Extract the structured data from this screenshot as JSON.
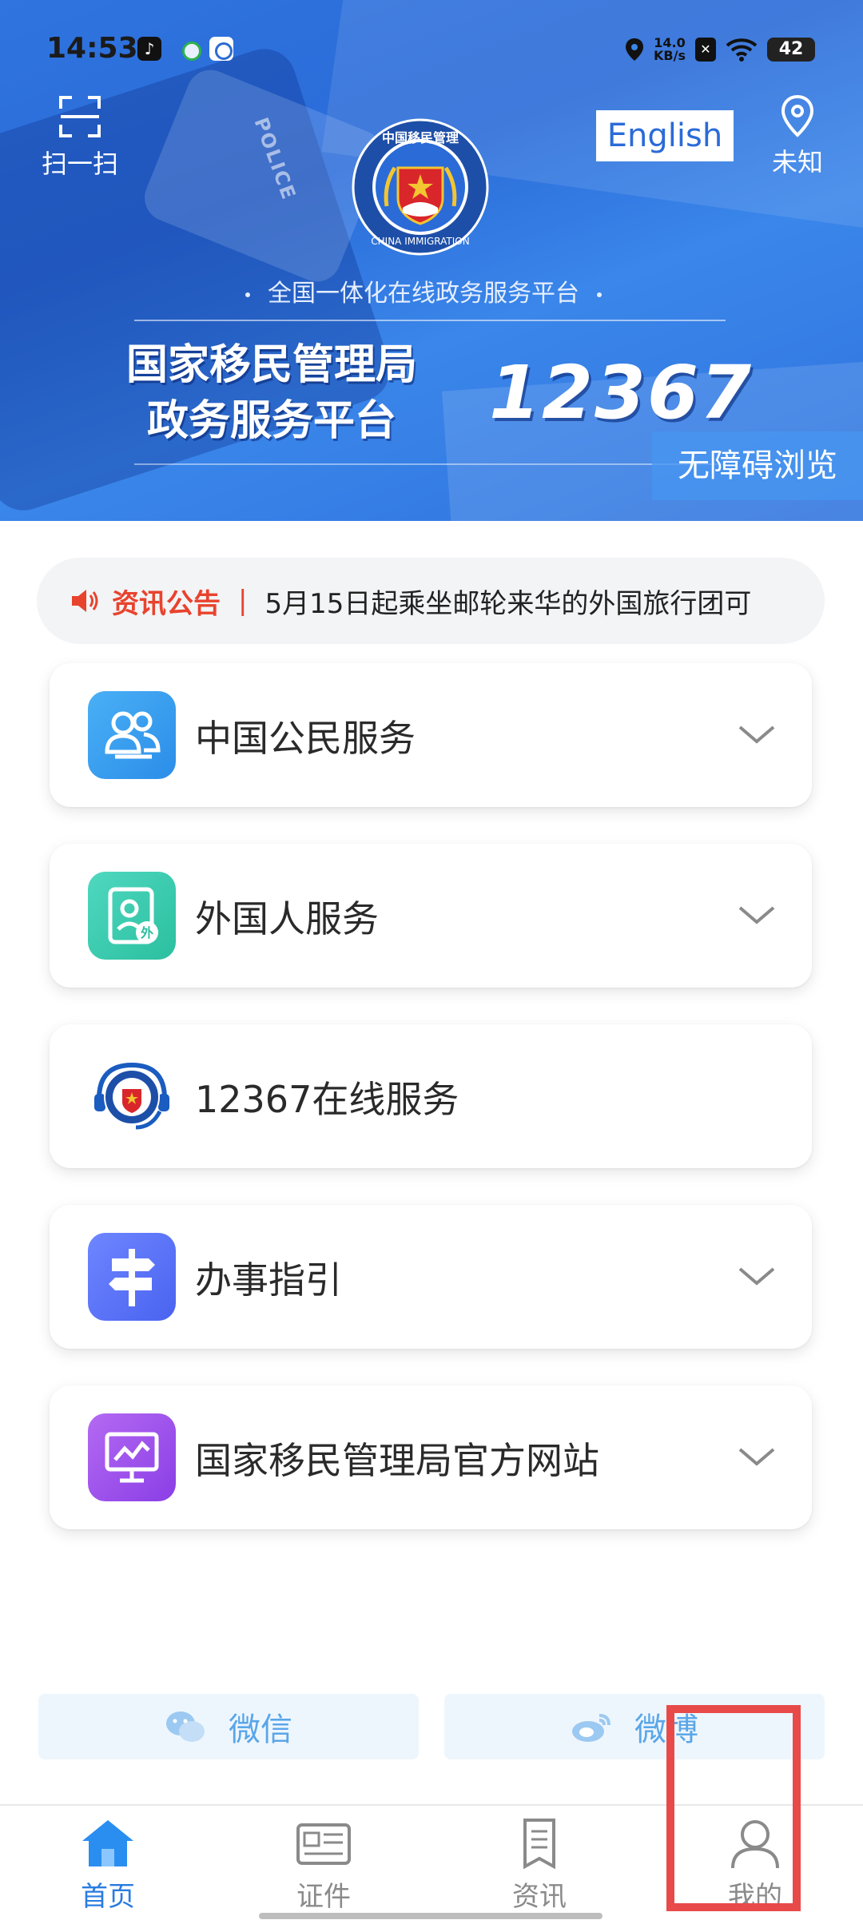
{
  "status_bar": {
    "time": "14:53",
    "net_speed_value": "14.0",
    "net_speed_unit": "KB/s",
    "battery": "42"
  },
  "header": {
    "scan_label": "扫一扫",
    "language_button": "English",
    "location_label": "未知",
    "emblem_text": "中国移民管理 CHINA IMMIGRATION",
    "police_text": "POLICE",
    "subtitle": "全国一体化在线政务服务平台",
    "title_line1": "国家移民管理局",
    "title_line2": "政务服务平台",
    "hotline": "12367",
    "accessible_button": "无障碍浏览"
  },
  "notice": {
    "label": "资讯公告",
    "separator": "|",
    "message": "5月15日起乘坐邮轮来华的外国旅行团可"
  },
  "services": [
    {
      "label": "中国公民服务",
      "icon": "citizen-group-icon",
      "expandable": true
    },
    {
      "label": "外国人服务",
      "icon": "foreigner-id-icon",
      "expandable": true
    },
    {
      "label": "12367在线服务",
      "icon": "immigration-emblem-headset-icon",
      "expandable": false
    },
    {
      "label": "办事指引",
      "icon": "signpost-icon",
      "expandable": true
    },
    {
      "label": "国家移民管理局官方网站",
      "icon": "monitor-chart-icon",
      "expandable": true
    }
  ],
  "social": {
    "wechat": "微信",
    "weibo": "微博"
  },
  "tabs": [
    {
      "label": "首页",
      "icon": "home-icon",
      "active": true
    },
    {
      "label": "证件",
      "icon": "id-card-icon",
      "active": false
    },
    {
      "label": "资讯",
      "icon": "news-icon",
      "active": false
    },
    {
      "label": "我的",
      "icon": "user-icon",
      "active": false
    }
  ],
  "colors": {
    "banner_blue": "#2f74df",
    "accent_blue": "#2a7be0",
    "notice_red": "#e8432d",
    "highlight_red": "#e84a4a"
  }
}
